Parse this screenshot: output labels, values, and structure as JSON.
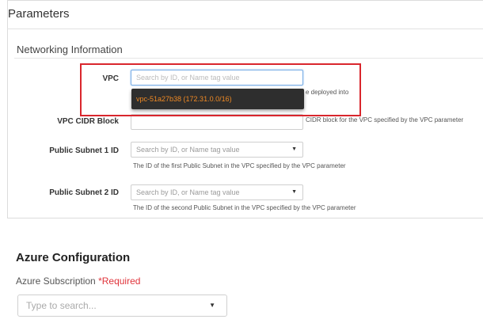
{
  "parameters": {
    "title": "Parameters",
    "section": "Networking Information",
    "vpc": {
      "label": "VPC",
      "placeholder": "Search by ID, or Name tag value",
      "dropdown_option": "vpc-51a27b38 (172.31.0.0/16)",
      "help": "e deployed into"
    },
    "cidr": {
      "label": "VPC CIDR Block",
      "help": "CIDR block for the VPC specified by the VPC parameter"
    },
    "subnet1": {
      "label": "Public Subnet 1 ID",
      "placeholder": "Search by ID, or Name tag value",
      "help": "The ID of the first Public Subnet in the VPC specified by the VPC parameter"
    },
    "subnet2": {
      "label": "Public Subnet 2 ID",
      "placeholder": "Search by ID, or Name tag value",
      "help": "The ID of the second Public Subnet in the VPC specified by the VPC parameter"
    },
    "caret_icon": "chevron-down-icon",
    "highlight_color": "#d9262d",
    "option_color": "#f08a24"
  },
  "azure": {
    "title": "Azure Configuration",
    "subscription_label": "Azure Subscription",
    "required": "*Required",
    "search_placeholder": "Type to search..."
  }
}
